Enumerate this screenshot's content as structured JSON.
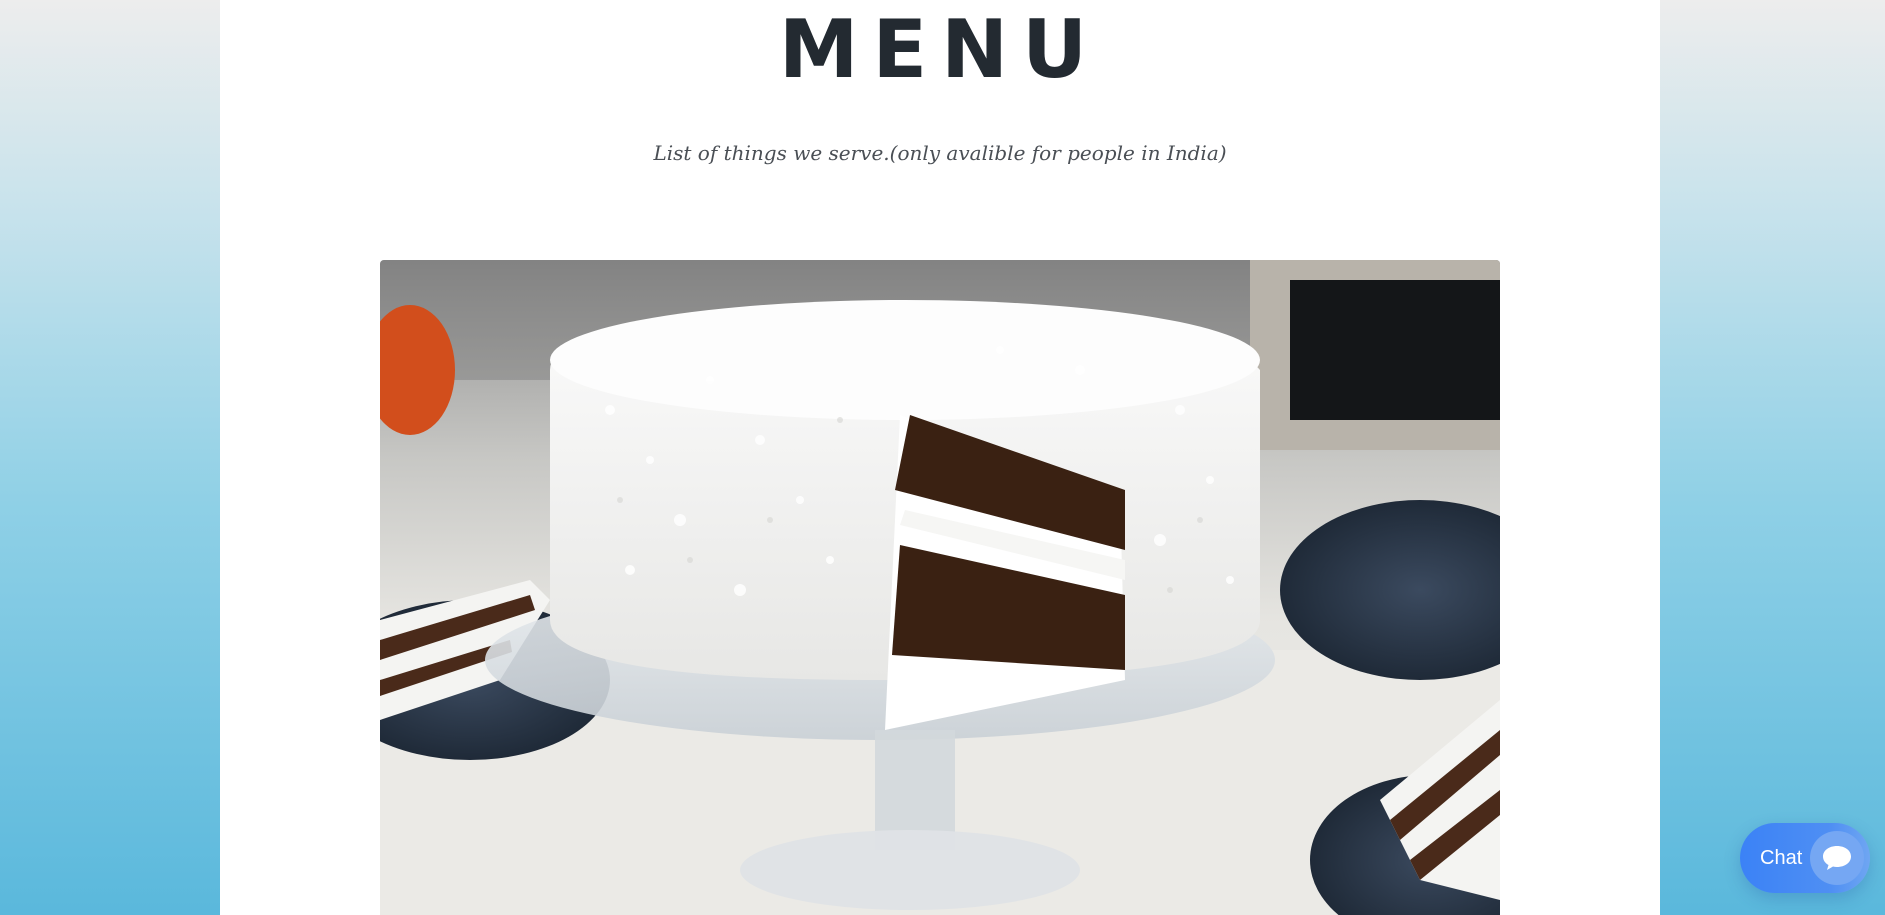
{
  "header": {
    "title": "MENU",
    "subtitle": "List of things we serve.(only avalible for people in India)"
  },
  "hero": {
    "image_subject": "coconut layer cake on glass cake stand"
  },
  "chat_widget": {
    "label": "Chat",
    "icon": "chat-bubble-icon"
  },
  "colors": {
    "title_text": "#232a31",
    "subtitle_text": "#4a4f55",
    "chat_button": "#3b82f6",
    "page_background_top": "#ededed",
    "page_background_bottom": "#5ab8dc"
  }
}
